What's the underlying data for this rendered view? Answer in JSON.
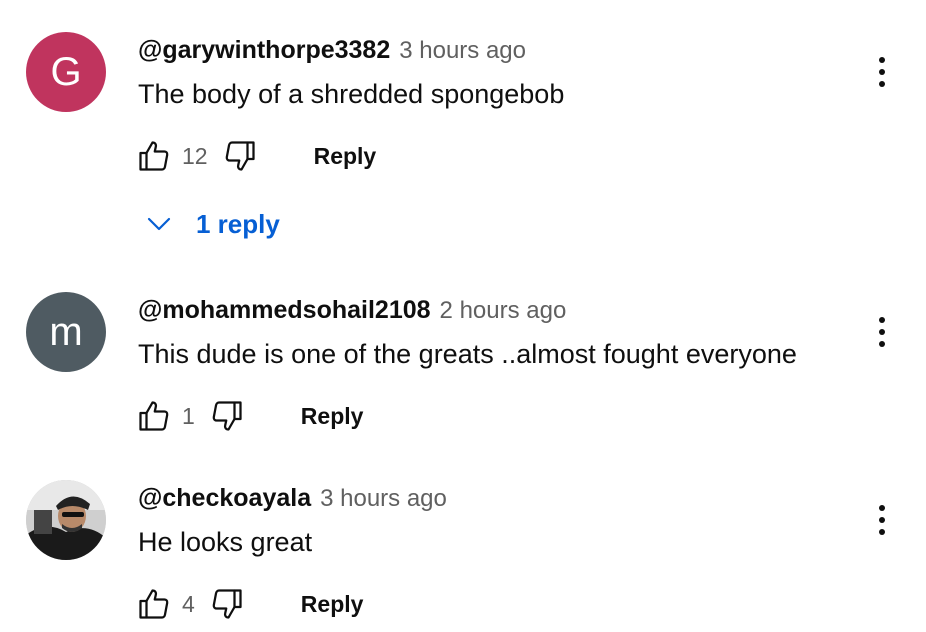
{
  "colors": {
    "avatar_g": "#c0345e",
    "avatar_m": "#4f5b62",
    "link_blue": "#065fd4"
  },
  "comments": [
    {
      "avatar_letter": "G",
      "author": "@garywinthorpe3382",
      "time": "3 hours ago",
      "text": "The body of a shredded spongebob",
      "likes": "12",
      "reply_label": "Reply",
      "replies_label": "1 reply"
    },
    {
      "avatar_letter": "m",
      "author": "@mohammedsohail2108",
      "time": "2 hours ago",
      "text": "This dude is one of the greats ..almost fought everyone",
      "likes": "1",
      "reply_label": "Reply"
    },
    {
      "avatar_letter": "",
      "author": "@checkoayala",
      "time": "3 hours ago",
      "text": "He looks great",
      "likes": "4",
      "reply_label": "Reply"
    }
  ],
  "icons": {
    "like": "thumbs-up-icon",
    "dislike": "thumbs-down-icon",
    "menu": "more-vertical-icon",
    "expand": "chevron-down-icon"
  }
}
